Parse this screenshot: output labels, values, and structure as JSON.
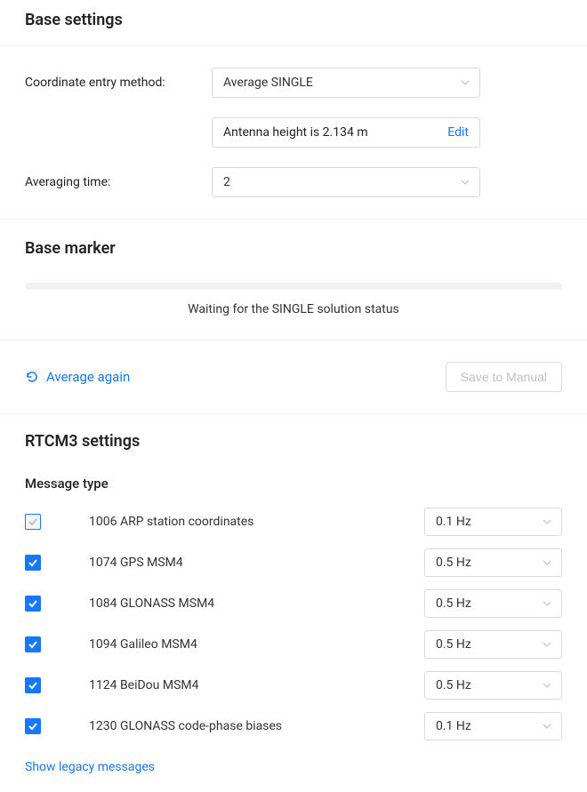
{
  "base_settings": {
    "heading": "Base settings",
    "coord_method_label": "Coordinate entry method:",
    "coord_method_value": "Average SINGLE",
    "antenna_text": "Antenna height is 2.134 m",
    "edit_label": "Edit",
    "averaging_time_label": "Averaging time:",
    "averaging_time_value": "2"
  },
  "base_marker": {
    "heading": "Base marker",
    "status_text": "Waiting for the SINGLE solution status",
    "average_again_label": "Average again",
    "save_label": "Save to Manual"
  },
  "rtcm3": {
    "heading": "RTCM3 settings",
    "subheading": "Message type",
    "legacy_link": "Show legacy messages",
    "messages": [
      {
        "label": "1006 ARP station coordinates",
        "freq": "0.1 Hz",
        "checked": true,
        "disabled": true
      },
      {
        "label": "1074 GPS MSM4",
        "freq": "0.5 Hz",
        "checked": true,
        "disabled": false
      },
      {
        "label": "1084 GLONASS MSM4",
        "freq": "0.5 Hz",
        "checked": true,
        "disabled": false
      },
      {
        "label": "1094 Galileo MSM4",
        "freq": "0.5 Hz",
        "checked": true,
        "disabled": false
      },
      {
        "label": "1124 BeiDou MSM4",
        "freq": "0.5 Hz",
        "checked": true,
        "disabled": false
      },
      {
        "label": "1230 GLONASS code-phase biases",
        "freq": "0.1 Hz",
        "checked": true,
        "disabled": false
      }
    ]
  }
}
